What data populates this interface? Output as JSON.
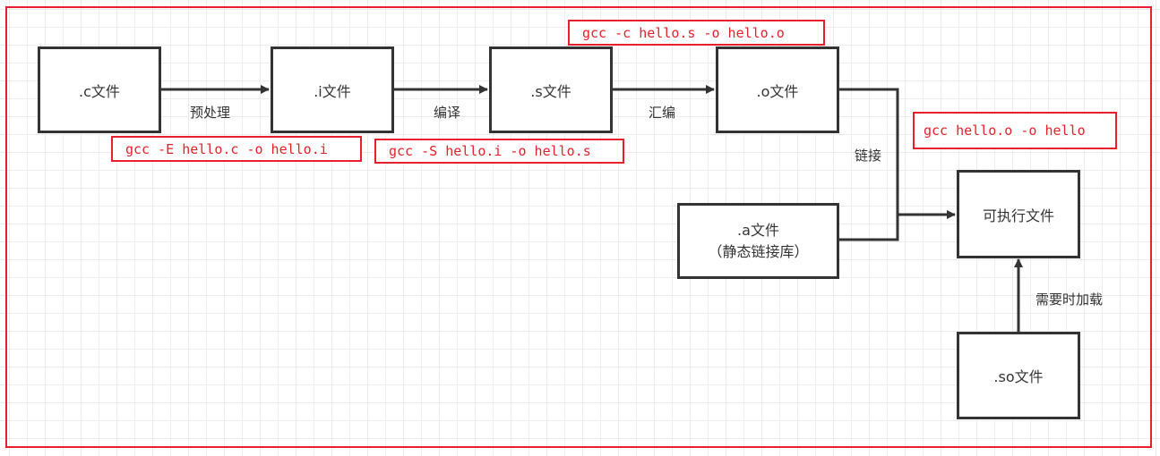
{
  "nodes": {
    "c_file": ".c文件",
    "i_file": ".i文件",
    "s_file": ".s文件",
    "o_file": ".o文件",
    "a_file": ".a文件",
    "a_file_sub": "（静态链接库）",
    "executable": "可执行文件",
    "so_file": ".so文件"
  },
  "edges": {
    "preprocess": "预处理",
    "compile": "编译",
    "assemble": "汇编",
    "link": "链接",
    "load_on_demand": "需要时加载"
  },
  "commands": {
    "preprocess": "gcc -E hello.c -o hello.i",
    "compile": "gcc -S hello.i -o hello.s",
    "assemble": "gcc -c hello.s -o hello.o",
    "link": "gcc hello.o -o hello"
  },
  "colors": {
    "annotation": "#e8202a",
    "stroke": "#333333"
  }
}
